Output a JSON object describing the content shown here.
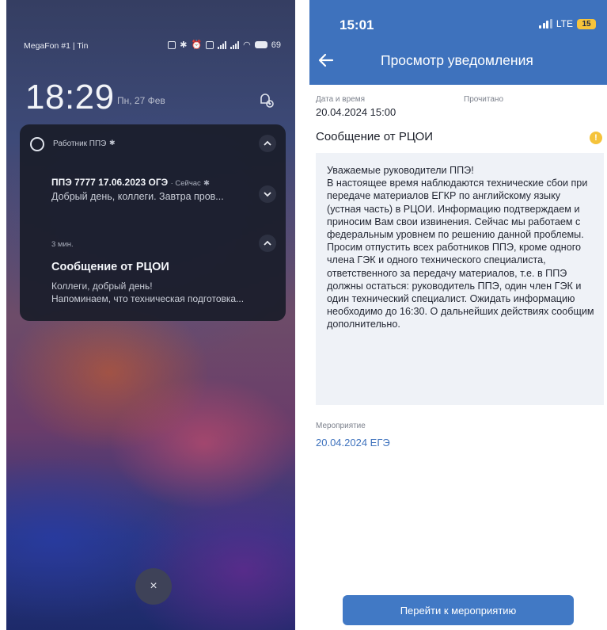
{
  "lockscreen": {
    "carrier": "MegaFon #1 | Tin",
    "battery": "69",
    "time": "18:29",
    "date": "Пн, 27 Фев",
    "notification_group": {
      "app_name": "Работник ППЭ",
      "items": [
        {
          "title": "ППЭ 7777 17.06.2023 ОГЭ",
          "meta": "· Сейчас",
          "body": "Добрый день, коллеги. Завтра пров..."
        },
        {
          "time": "3 мин.",
          "title": "Сообщение от РЦОИ",
          "body_line1": "Коллеги, добрый день!",
          "body_line2": "Напоминаем, что техническая подготовка..."
        }
      ]
    },
    "close_symbol": "×"
  },
  "app": {
    "status_time": "15:01",
    "network": "LTE",
    "battery": "15",
    "header_title": "Просмотр уведомления",
    "date_label": "Дата и время",
    "date_value": "20.04.2024 15:00",
    "read_label": "Прочитано",
    "message_title": "Сообщение от РЦОИ",
    "warning_symbol": "!",
    "message_body": "Уважаемые руководители ППЭ!\nВ настоящее время наблюдаются технические сбои при передаче материалов ЕГКР по английскому языку (устная часть) в РЦОИ. Информацию подтверждаем и приносим Вам свои извинения. Сейчас мы работаем с федеральным уровнем по решению данной проблемы.\nПросим отпустить всех работников ППЭ, кроме одного члена ГЭК и одного технического специалиста, ответственного за передачу материалов, т.е. в ППЭ должны остаться: руководитель ППЭ, один член ГЭК и один технический специалист. Ожидать информацию необходимо до 16:30. О дальнейших действиях сообщим дополнительно.",
    "event_label": "Мероприятие",
    "event_value": "20.04.2024 ЕГЭ",
    "go_button": "Перейти к мероприятию"
  },
  "colors": {
    "app_header": "#3e72bd",
    "button": "#4179c5",
    "warning": "#f5c33b",
    "link": "#3e72bd"
  }
}
